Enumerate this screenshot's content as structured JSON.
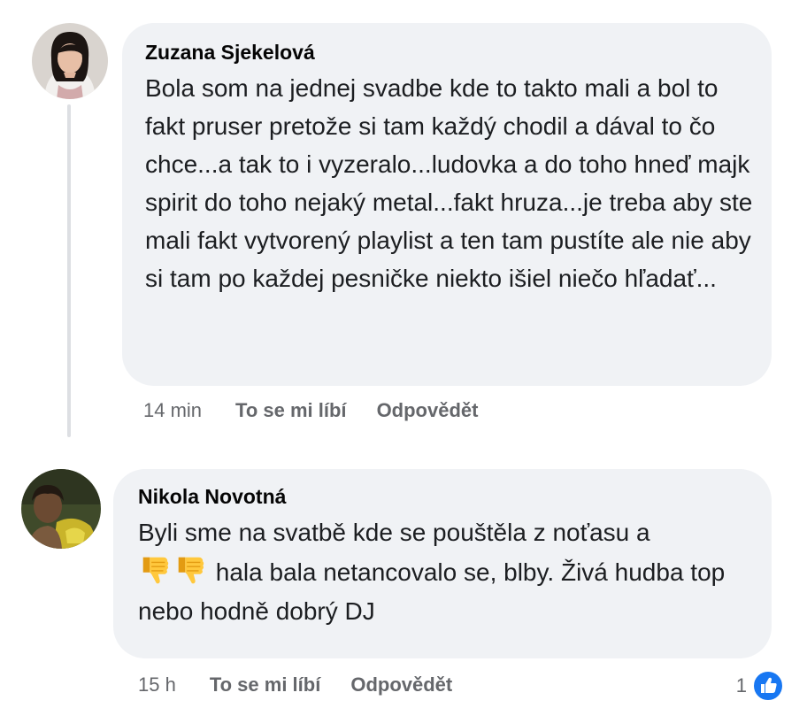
{
  "comments": [
    {
      "author": "Zuzana Sjekelová",
      "text": "Bola som na jednej svadbe kde to takto mali a bol to fakt pruser pretože si tam každý chodil a dával to čo chce...a tak to i vyzeralo...ludovka a do toho hneď majk spirit do toho nejaký metal...fakt hruza...je treba aby ste mali fakt vytvorený playlist a ten tam pustíte ale nie aby si tam po každej pesničke niekto išiel niečo hľadať...",
      "time": "14 min",
      "like_label": "To se mi líbí",
      "reply_label": "Odpovědět"
    },
    {
      "author": "Nikola Novotná",
      "text_line1": "Byli sme na svatbě kde se pouštěla z noťasu a",
      "emojis": [
        "thumbs-down-emoji",
        "thumbs-down-emoji"
      ],
      "text_rest": "hala bala netancovalo se, blby. Živá hudba top nebo hodně dobrý DJ",
      "time": "15 h",
      "like_label": "To se mi líbí",
      "reply_label": "Odpovědět",
      "reaction_count": "1",
      "reaction_icon": "like-icon"
    }
  ],
  "colors": {
    "bubble": "#f0f2f5",
    "meta_text": "#65676b",
    "like_blue": "#1877f2"
  }
}
